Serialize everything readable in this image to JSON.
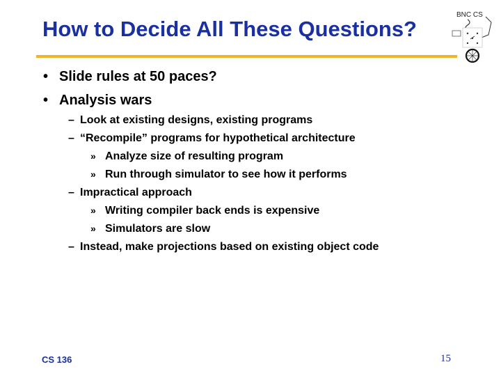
{
  "slide": {
    "title": "How to Decide All These Questions?",
    "accent_color": "#f0b429",
    "title_color": "#1a2fa0",
    "logo": {
      "icon": "bnc-cs-cartoon-logo-icon",
      "text": "BNC CS"
    },
    "bullets": [
      {
        "marker": "•",
        "text": "Slide rules at 50 paces?"
      },
      {
        "marker": "•",
        "text": "Analysis wars"
      }
    ],
    "sub_items": [
      {
        "marker": "–",
        "text": "Look at existing designs, existing programs"
      },
      {
        "marker": "–",
        "text": "“Recompile” programs for hypothetical architecture"
      },
      {
        "marker": "»",
        "text": "Analyze size of resulting program"
      },
      {
        "marker": "»",
        "text": "Run through simulator to see how it performs"
      },
      {
        "marker": "–",
        "text": "Impractical approach"
      },
      {
        "marker": "»",
        "text": "Writing compiler back ends is expensive"
      },
      {
        "marker": "»",
        "text": "Simulators are slow"
      },
      {
        "marker": "–",
        "text": "Instead, make projections based on existing object code"
      }
    ],
    "footer": {
      "course": "CS 136",
      "page_number": "15"
    }
  }
}
